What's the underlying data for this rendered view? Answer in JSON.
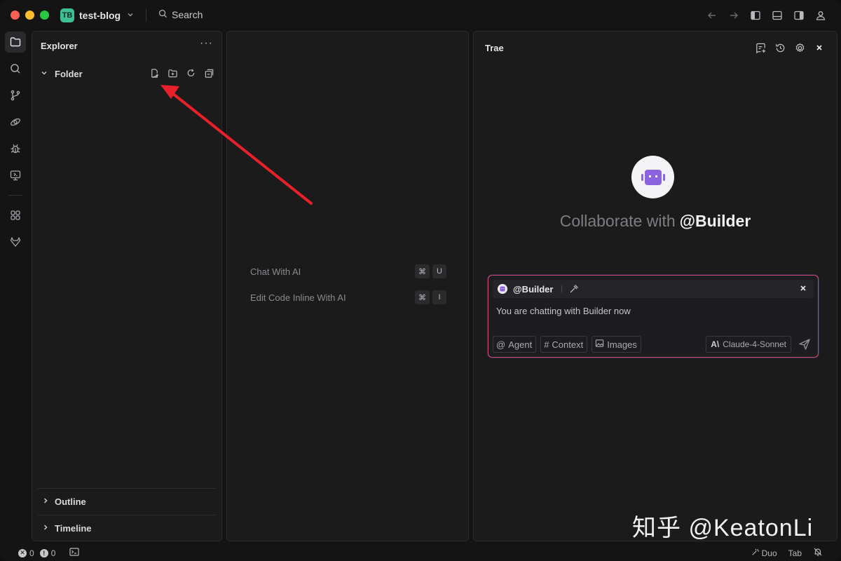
{
  "titlebar": {
    "project_badge": "TB",
    "project_name": "test-blog",
    "search_label": "Search"
  },
  "explorer": {
    "title": "Explorer",
    "more": "···",
    "folder_label": "Folder",
    "outline_label": "Outline",
    "timeline_label": "Timeline"
  },
  "editor": {
    "hints": [
      {
        "label": "Chat With AI",
        "keys": [
          "⌘",
          "U"
        ]
      },
      {
        "label": "Edit Code Inline With AI",
        "keys": [
          "⌘",
          "I"
        ]
      }
    ]
  },
  "chat": {
    "title": "Trae",
    "collab_prefix": "Collaborate with",
    "collab_agent": "@Builder",
    "composer": {
      "agent_tag": "@Builder",
      "message": "You are chatting with Builder now",
      "chips": {
        "agent": "Agent",
        "context": "Context",
        "images": "Images"
      },
      "model": "Claude-4-Sonnet"
    }
  },
  "status": {
    "errors": "0",
    "warnings": "0",
    "duo": "Duo",
    "tab": "Tab"
  },
  "watermark": "知乎 @KeatonLi",
  "colors": {
    "accent_badge": "#3fbf95",
    "bot_purple": "#8b63e0",
    "composer_border": "#c9467a",
    "annotation_arrow": "#e8202a"
  }
}
